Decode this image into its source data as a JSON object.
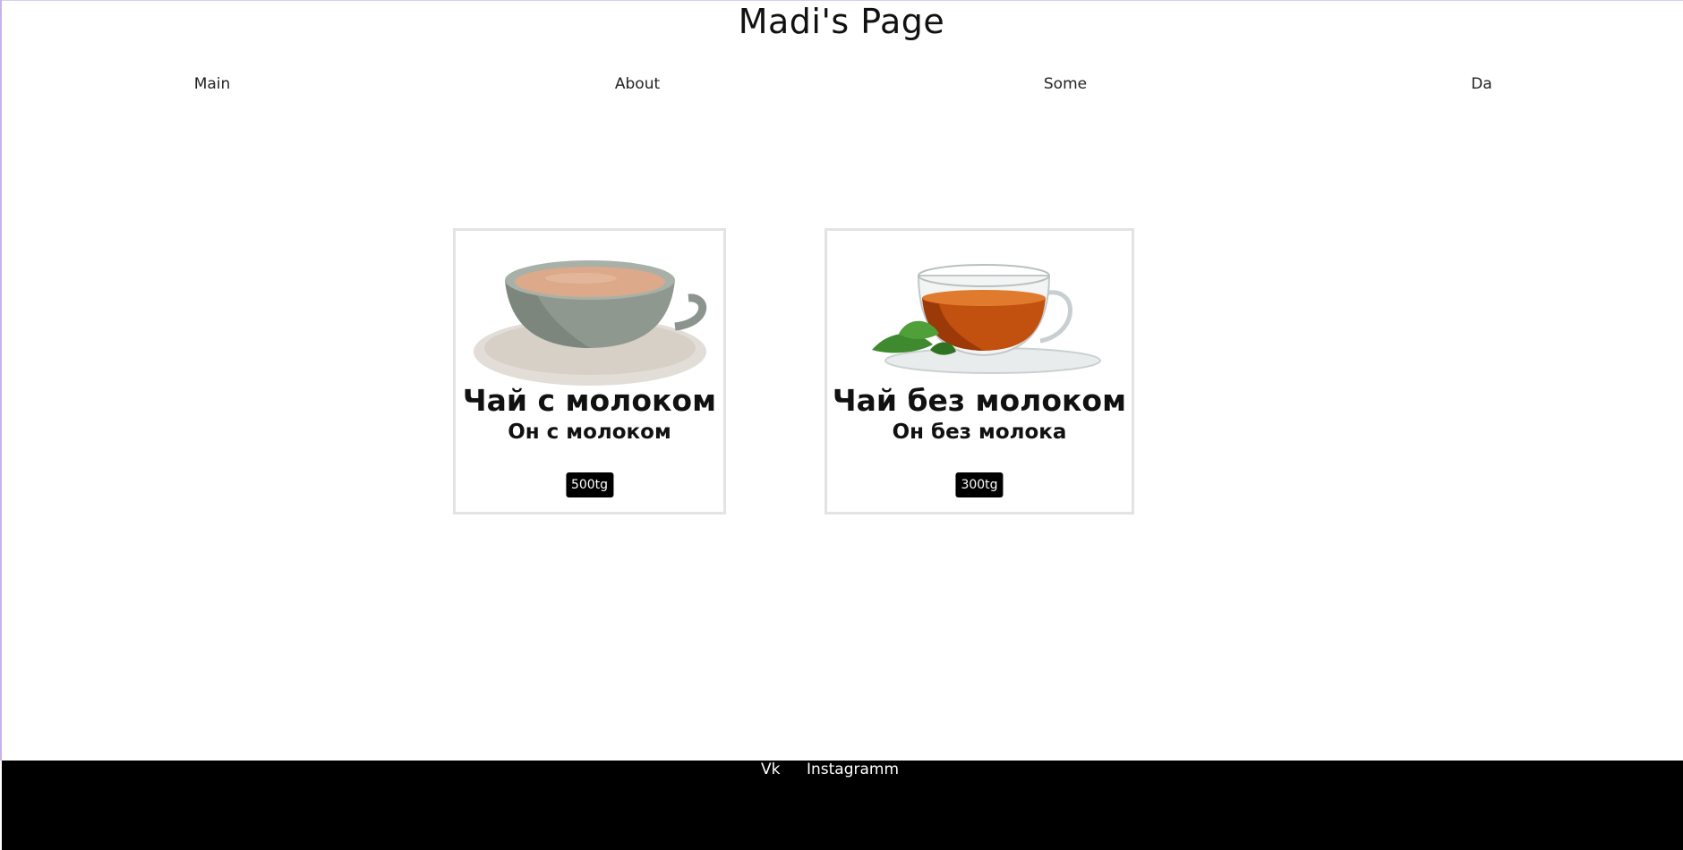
{
  "header": {
    "title": "Madi's Page",
    "nav": [
      {
        "label": "Main"
      },
      {
        "label": "About"
      },
      {
        "label": "Some"
      },
      {
        "label": "Da"
      }
    ]
  },
  "products": [
    {
      "title": "Чай с молоком",
      "subtitle": "Он с молоком",
      "price": "500tg",
      "image_icon": "milk-tea-cup-icon"
    },
    {
      "title": "Чай без молоком",
      "subtitle": "Он без молока",
      "price": "300tg",
      "image_icon": "black-tea-cup-icon"
    }
  ],
  "footer": {
    "links": [
      {
        "label": "Vk"
      },
      {
        "label": "Instagramm"
      }
    ]
  },
  "colors": {
    "background": "#ffffff",
    "footer": "#000000",
    "badge": "#000000",
    "card_border": "#e3e3e3"
  }
}
